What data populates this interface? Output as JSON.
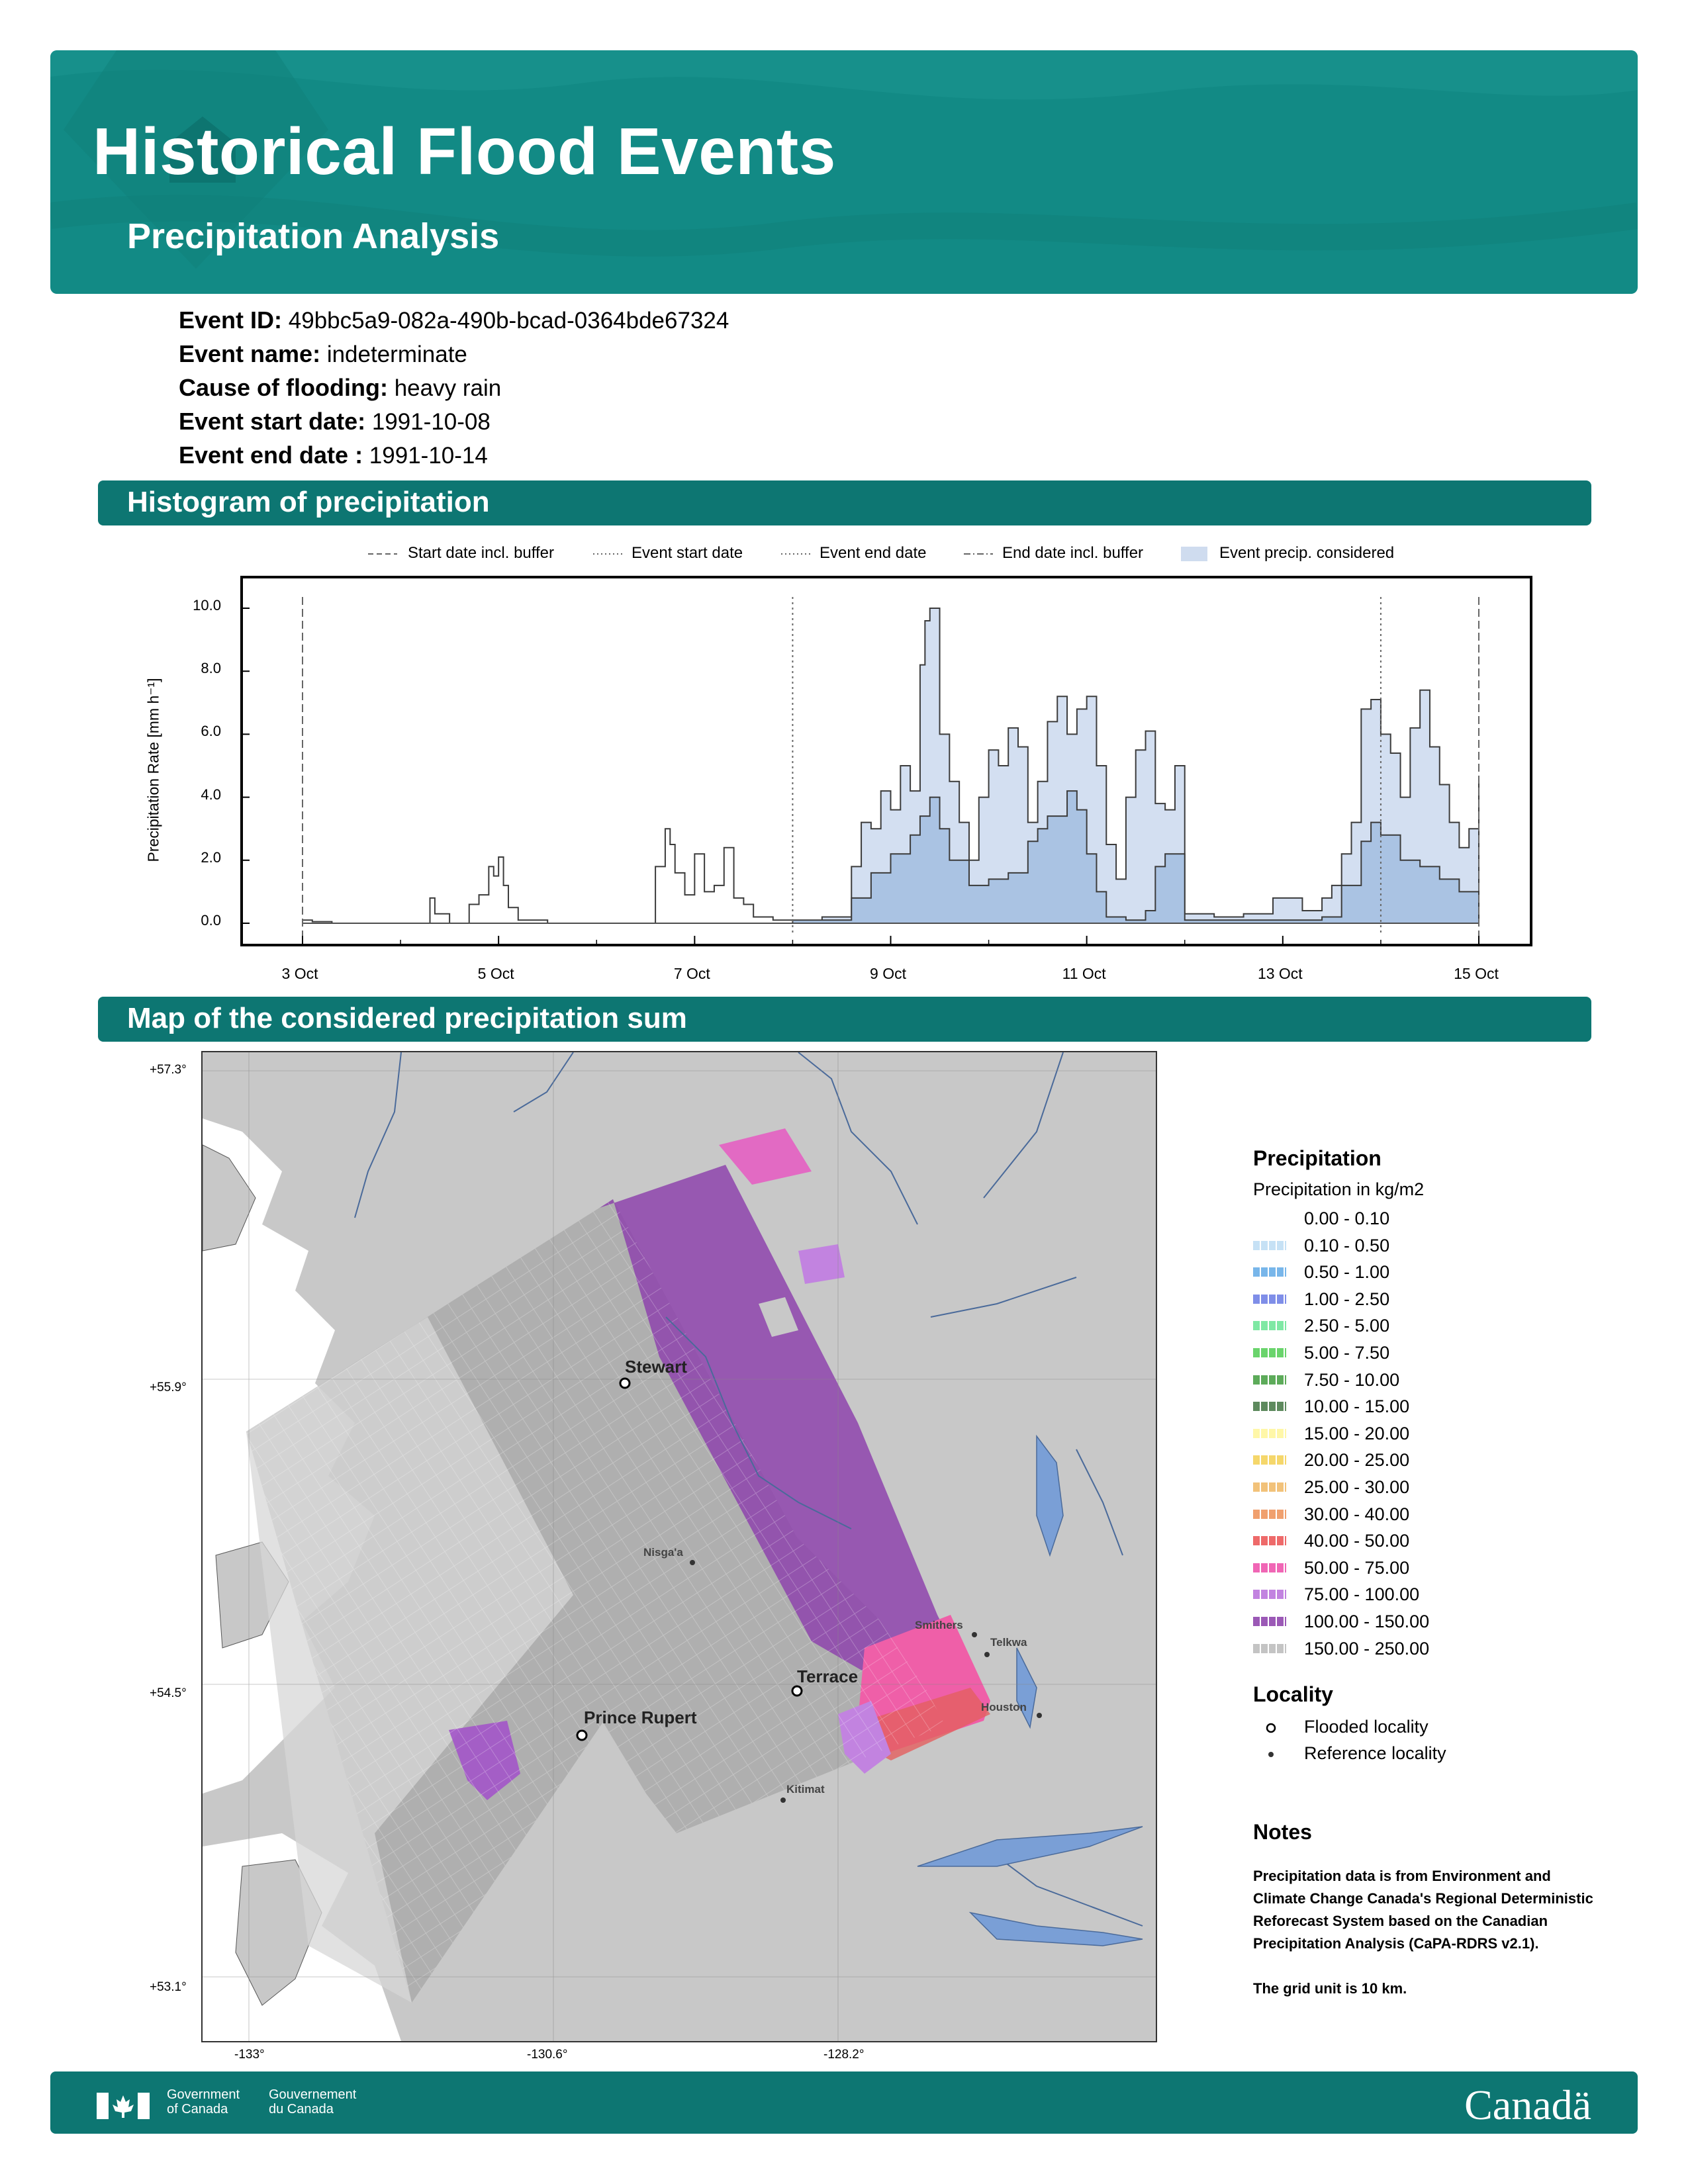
{
  "header": {
    "title": "Historical Flood Events",
    "subtitle": "Precipitation Analysis"
  },
  "event": {
    "id_label": "Event ID:",
    "id_value": "49bbc5a9-082a-490b-bcad-0364bde67324",
    "name_label": "Event name:",
    "name_value": "indeterminate",
    "cause_label": "Cause of flooding:",
    "cause_value": "heavy rain",
    "start_label": "Event start date:",
    "start_value": "1991-10-08",
    "end_label": "Event end date :",
    "end_value": "1991-10-14"
  },
  "sections": {
    "histogram": "Histogram of precipitation",
    "map": "Map of the considered precipitation sum"
  },
  "chart_data": {
    "type": "area",
    "title": "",
    "ylabel": "Precipitation Rate [mm h⁻¹]",
    "xlabel": "",
    "ylim": [
      0,
      10.0
    ],
    "y_ticks": [
      "0.0",
      "2.0",
      "4.0",
      "6.0",
      "8.0",
      "10.0"
    ],
    "x_ticks": [
      "3 Oct",
      "5 Oct",
      "7 Oct",
      "9 Oct",
      "11 Oct",
      "13 Oct",
      "15 Oct"
    ],
    "x_tick_days": [
      3,
      5,
      7,
      9,
      11,
      13,
      15
    ],
    "legend": [
      {
        "label": "Start date incl. buffer",
        "style": "dashed"
      },
      {
        "label": "Event start date",
        "style": "dotted"
      },
      {
        "label": "Event end date",
        "style": "dotted"
      },
      {
        "label": "End date incl. buffer",
        "style": "dashdot"
      },
      {
        "label": "Event precip. considered",
        "style": "fill"
      }
    ],
    "vlines": [
      {
        "day": 3.0,
        "style": "dashed"
      },
      {
        "day": 8.0,
        "style": "dotted"
      },
      {
        "day": 14.0,
        "style": "dotted"
      },
      {
        "day": 15.0,
        "style": "dashed"
      }
    ],
    "series": [
      {
        "values_day": [
          3.0,
          3.1,
          3.3,
          4.0,
          4.25,
          4.3,
          4.35,
          4.5,
          4.7,
          4.8,
          4.9,
          4.95,
          5.0,
          5.05,
          5.1,
          5.2,
          5.5,
          6.0,
          6.5,
          6.6,
          6.7,
          6.75,
          6.8,
          6.9,
          7.0,
          7.1,
          7.2,
          7.3,
          7.4,
          7.5,
          7.6,
          7.8,
          8.0,
          8.3,
          8.6,
          8.7,
          8.8,
          8.9,
          9.0,
          9.1,
          9.2,
          9.3,
          9.35,
          9.4,
          9.5,
          9.6,
          9.7,
          9.8,
          9.9,
          10.0,
          10.1,
          10.2,
          10.3,
          10.4,
          10.5,
          10.6,
          10.7,
          10.8,
          10.9,
          11.0,
          11.1,
          11.2,
          11.3,
          11.4,
          11.5,
          11.6,
          11.7,
          11.8,
          11.9,
          12.0,
          12.3,
          12.6,
          12.9,
          13.2,
          13.4,
          13.5,
          13.6,
          13.7,
          13.8,
          13.9,
          14.0,
          14.1,
          14.2,
          14.3,
          14.4,
          14.5,
          14.6,
          14.7,
          14.8,
          14.9,
          15.0
        ],
        "values": [
          0.1,
          0.05,
          0.0,
          0.0,
          0.0,
          0.8,
          0.3,
          0.0,
          0.6,
          0.9,
          1.8,
          1.5,
          2.1,
          1.2,
          0.5,
          0.1,
          0.0,
          0.0,
          0.0,
          1.8,
          3.0,
          2.5,
          1.6,
          0.9,
          2.2,
          1.0,
          1.2,
          2.4,
          0.8,
          0.6,
          0.2,
          0.1,
          0.0,
          0.2,
          1.8,
          3.2,
          3.0,
          4.2,
          3.6,
          5.0,
          4.2,
          8.2,
          9.6,
          10.0,
          6.0,
          4.5,
          3.2,
          2.0,
          4.0,
          5.5,
          5.0,
          6.2,
          5.6,
          3.2,
          4.5,
          6.4,
          7.2,
          6.0,
          6.8,
          7.2,
          5.0,
          2.5,
          1.4,
          4.0,
          5.5,
          6.1,
          3.8,
          3.6,
          5.0,
          0.3,
          0.2,
          0.3,
          0.8,
          0.4,
          0.8,
          1.2,
          2.2,
          3.2,
          6.8,
          7.1,
          6.0,
          5.4,
          4.0,
          6.2,
          7.4,
          5.6,
          4.4,
          3.2,
          2.4,
          3.0,
          4.6
        ]
      },
      {
        "values_day": [
          8.0,
          8.6,
          8.8,
          9.0,
          9.2,
          9.3,
          9.4,
          9.5,
          9.6,
          9.8,
          10.0,
          10.2,
          10.4,
          10.5,
          10.6,
          10.8,
          10.9,
          11.0,
          11.1,
          11.2,
          11.4,
          11.6,
          11.7,
          11.8,
          12.0,
          13.4,
          13.6,
          13.8,
          13.9,
          14.0,
          14.2,
          14.4,
          14.6,
          14.8,
          15.0
        ],
        "values": [
          0.1,
          0.8,
          1.6,
          2.2,
          2.8,
          3.4,
          4.0,
          3.0,
          2.0,
          1.2,
          1.4,
          1.6,
          2.6,
          3.0,
          3.4,
          4.2,
          3.6,
          2.2,
          1.0,
          0.2,
          0.1,
          0.4,
          1.8,
          2.2,
          0.1,
          0.2,
          1.2,
          2.6,
          3.2,
          2.8,
          2.0,
          1.8,
          1.4,
          1.0,
          1.1
        ]
      }
    ]
  },
  "map": {
    "coords_lat": [
      "+57.3°",
      "+55.9°",
      "+54.5°",
      "+53.1°"
    ],
    "coords_lon": [
      "-133°",
      "-130.6°",
      "-128.2°"
    ],
    "places": {
      "stewart": "Stewart",
      "nisgaa": "Nisga'a",
      "smithers": "Smithers",
      "telkwa": "Telkwa",
      "terrace": "Terrace",
      "houston": "Houston",
      "prince_rupert": "Prince Rupert",
      "kitimat": "Kitimat"
    }
  },
  "legend": {
    "title": "Precipitation",
    "subtitle": "Precipitation in kg/m2",
    "classes": [
      {
        "label": "0.00 - 0.10",
        "color": "#ffffff"
      },
      {
        "label": "0.10 - 0.50",
        "color": "#c6e1f5"
      },
      {
        "label": "0.50 - 1.00",
        "color": "#78b6ea"
      },
      {
        "label": "1.00 - 2.50",
        "color": "#7f8ee8"
      },
      {
        "label": "2.50 - 5.00",
        "color": "#7fe8a4"
      },
      {
        "label": "5.00 - 7.50",
        "color": "#6ad46c"
      },
      {
        "label": "7.50 - 10.00",
        "color": "#5dab5a"
      },
      {
        "label": "10.00 - 15.00",
        "color": "#5e8a5e"
      },
      {
        "label": "15.00 - 20.00",
        "color": "#fff7a8"
      },
      {
        "label": "20.00 - 25.00",
        "color": "#f5d76b"
      },
      {
        "label": "25.00 - 30.00",
        "color": "#f2c27a"
      },
      {
        "label": "30.00 - 40.00",
        "color": "#f0a06e"
      },
      {
        "label": "40.00 - 50.00",
        "color": "#ee6a6a"
      },
      {
        "label": "50.00 - 75.00",
        "color": "#f066b5"
      },
      {
        "label": "75.00 - 100.00",
        "color": "#c283e0"
      },
      {
        "label": "100.00 - 150.00",
        "color": "#9b59b6"
      },
      {
        "label": "150.00 - 250.00",
        "color": "#c4c4c4"
      }
    ],
    "locality_title": "Locality",
    "flooded": "Flooded locality",
    "reference": "Reference locality",
    "notes_title": "Notes",
    "notes_text": "Precipitation data is from Environment and Climate Change Canada's Regional Deterministic Reforecast System based on the Canadian Precipitation Analysis (CaPA-RDRS v2.1).",
    "grid_note": "The grid unit is 10 km."
  },
  "footer": {
    "gov_en_1": "Government",
    "gov_en_2": "of Canada",
    "gov_fr_1": "Gouvernement",
    "gov_fr_2": "du Canada",
    "wordmark": "Canadä"
  }
}
